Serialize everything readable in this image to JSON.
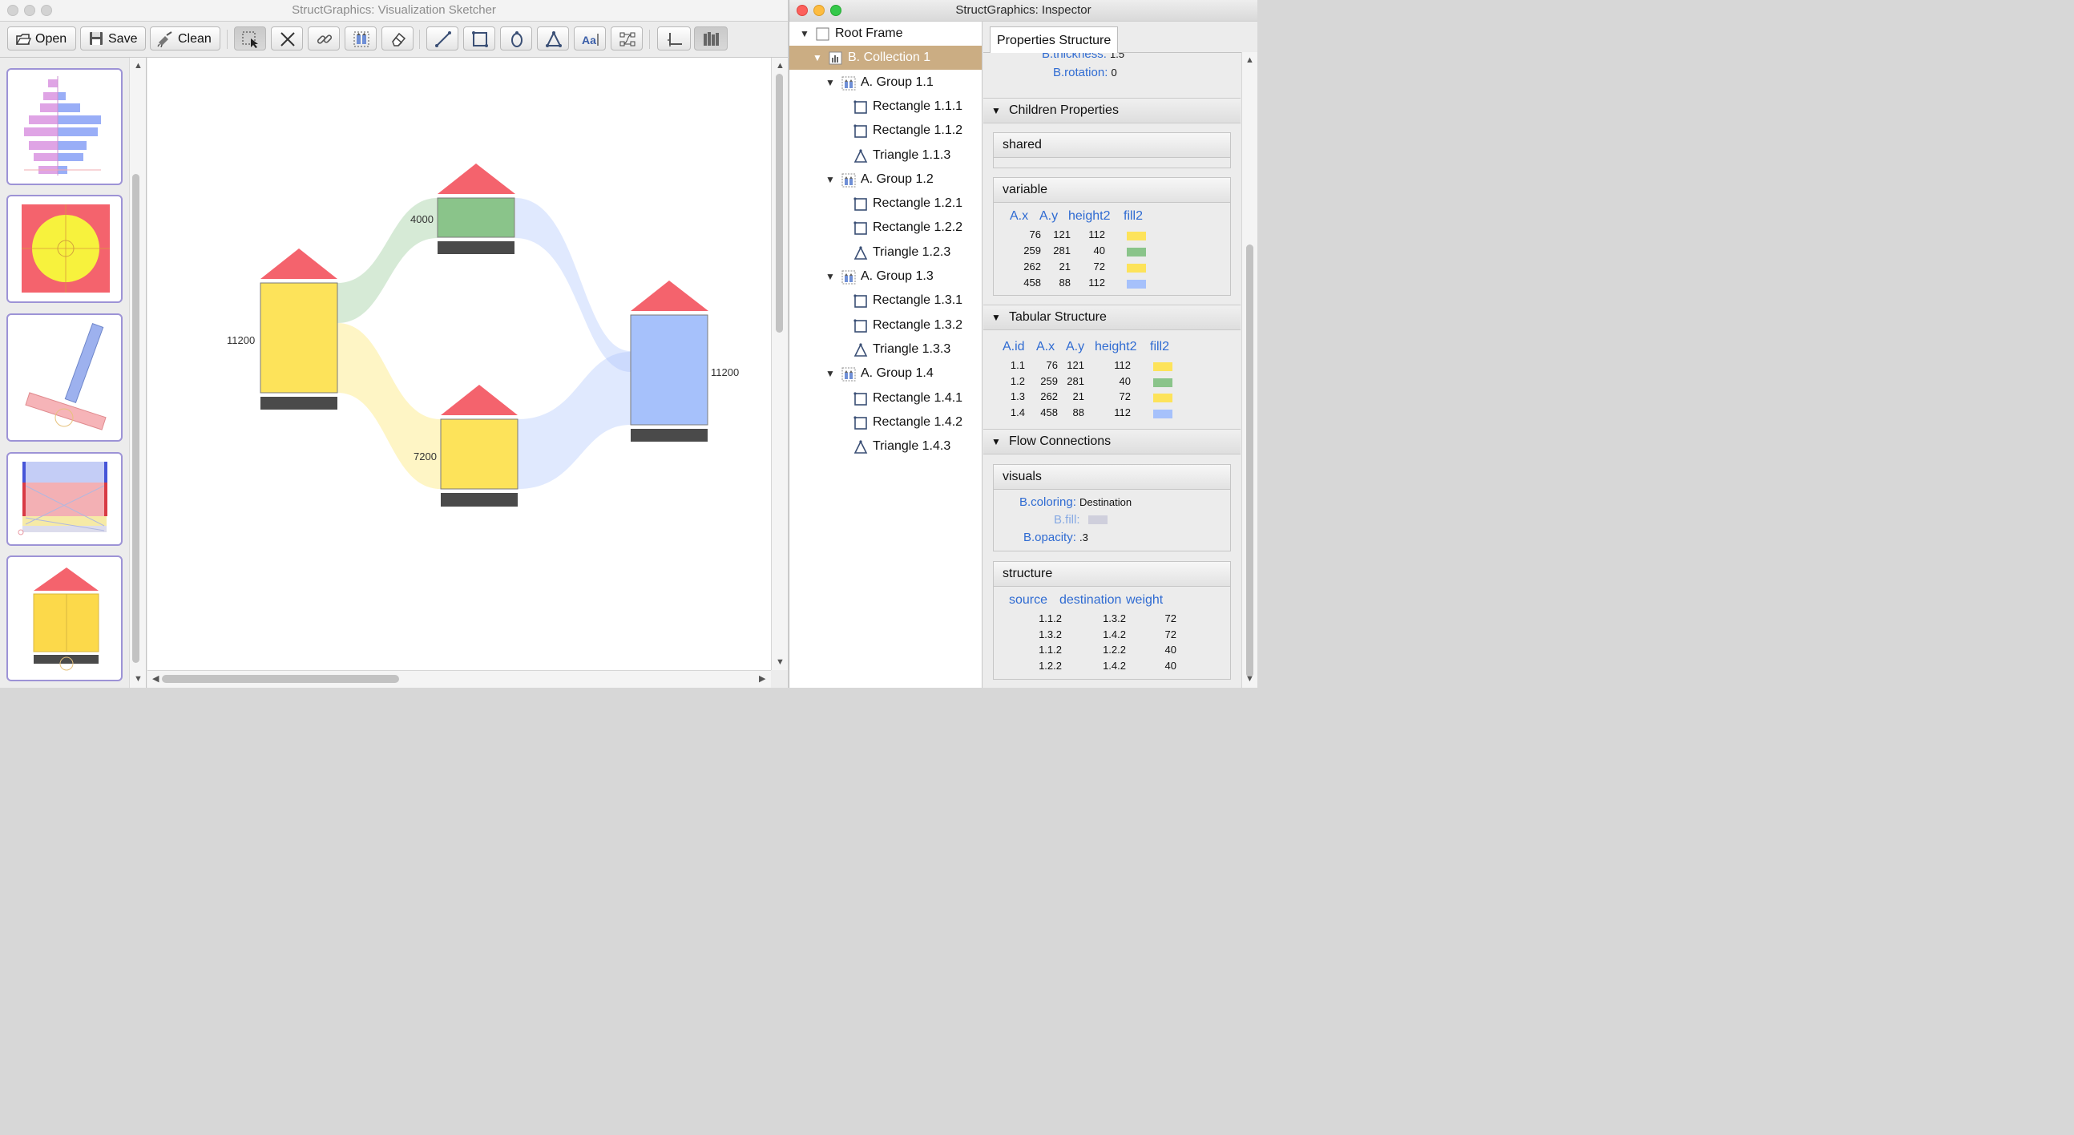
{
  "sketcher": {
    "title": "StructGraphics: Visualization Sketcher",
    "toolbar": {
      "open": "Open",
      "save": "Save",
      "clean": "Clean"
    },
    "labels": {
      "left": "11200",
      "top": "4000",
      "bottom": "7200",
      "right": "11200"
    }
  },
  "inspector": {
    "title": "StructGraphics: Inspector",
    "tree": [
      {
        "label": "Root Frame",
        "level": 0
      },
      {
        "label": "B. Collection 1",
        "level": 1,
        "selected": true
      },
      {
        "label": "A. Group 1.1",
        "level": 2
      },
      {
        "label": "Rectangle 1.1.1",
        "level": 3
      },
      {
        "label": "Rectangle 1.1.2",
        "level": 3
      },
      {
        "label": "Triangle 1.1.3",
        "level": 3
      },
      {
        "label": "A. Group 1.2",
        "level": 2
      },
      {
        "label": "Rectangle 1.2.1",
        "level": 3
      },
      {
        "label": "Rectangle 1.2.2",
        "level": 3
      },
      {
        "label": "Triangle 1.2.3",
        "level": 3
      },
      {
        "label": "A. Group 1.3",
        "level": 2
      },
      {
        "label": "Rectangle 1.3.1",
        "level": 3
      },
      {
        "label": "Rectangle 1.3.2",
        "level": 3
      },
      {
        "label": "Triangle 1.3.3",
        "level": 3
      },
      {
        "label": "A. Group 1.4",
        "level": 2
      },
      {
        "label": "Rectangle 1.4.1",
        "level": 3
      },
      {
        "label": "Rectangle 1.4.2",
        "level": 3
      },
      {
        "label": "Triangle 1.4.3",
        "level": 3
      }
    ],
    "tab": "Properties Structure",
    "top_props": {
      "thickness_key": "B.thickness:",
      "thickness_val": "1.5",
      "rotation_key": "B.rotation:",
      "rotation_val": "0"
    },
    "children": {
      "title": "Children Properties",
      "shared": "shared",
      "variable": "variable",
      "headers": [
        "A.x",
        "A.y",
        "height2",
        "fill2"
      ],
      "rows": [
        [
          "76",
          "121",
          "112",
          "#fde35a"
        ],
        [
          "259",
          "281",
          "40",
          "#8ac48a"
        ],
        [
          "262",
          "21",
          "72",
          "#fde35a"
        ],
        [
          "458",
          "88",
          "112",
          "#a6c1fb"
        ]
      ]
    },
    "tabular": {
      "title": "Tabular Structure",
      "headers": [
        "A.id",
        "A.x",
        "A.y",
        "height2",
        "fill2"
      ],
      "rows": [
        [
          "1.1",
          "76",
          "121",
          "112",
          "#fde35a"
        ],
        [
          "1.2",
          "259",
          "281",
          "40",
          "#8ac48a"
        ],
        [
          "1.3",
          "262",
          "21",
          "72",
          "#fde35a"
        ],
        [
          "1.4",
          "458",
          "88",
          "112",
          "#a6c1fb"
        ]
      ]
    },
    "flow": {
      "title": "Flow Connections",
      "visuals": "visuals",
      "coloring_key": "B.coloring:",
      "coloring_val": "Destination",
      "fill_key": "B.fill:",
      "fill_color": "#cfcfdc",
      "opacity_key": "B.opacity:",
      "opacity_val": ".3",
      "structure": "structure",
      "headers": [
        "source",
        "destination",
        "weight"
      ],
      "rows": [
        [
          "1.1.2",
          "1.3.2",
          "72"
        ],
        [
          "1.3.2",
          "1.4.2",
          "72"
        ],
        [
          "1.1.2",
          "1.2.2",
          "40"
        ],
        [
          "1.2.2",
          "1.4.2",
          "40"
        ]
      ]
    }
  },
  "colors": {
    "red": "#f4636d",
    "yellow": "#fde35a",
    "green": "#8ac48a",
    "blue": "#a6c1fb",
    "dark": "#4a4a4a",
    "selected": "#cbad83",
    "key": "#2f6bd2"
  }
}
